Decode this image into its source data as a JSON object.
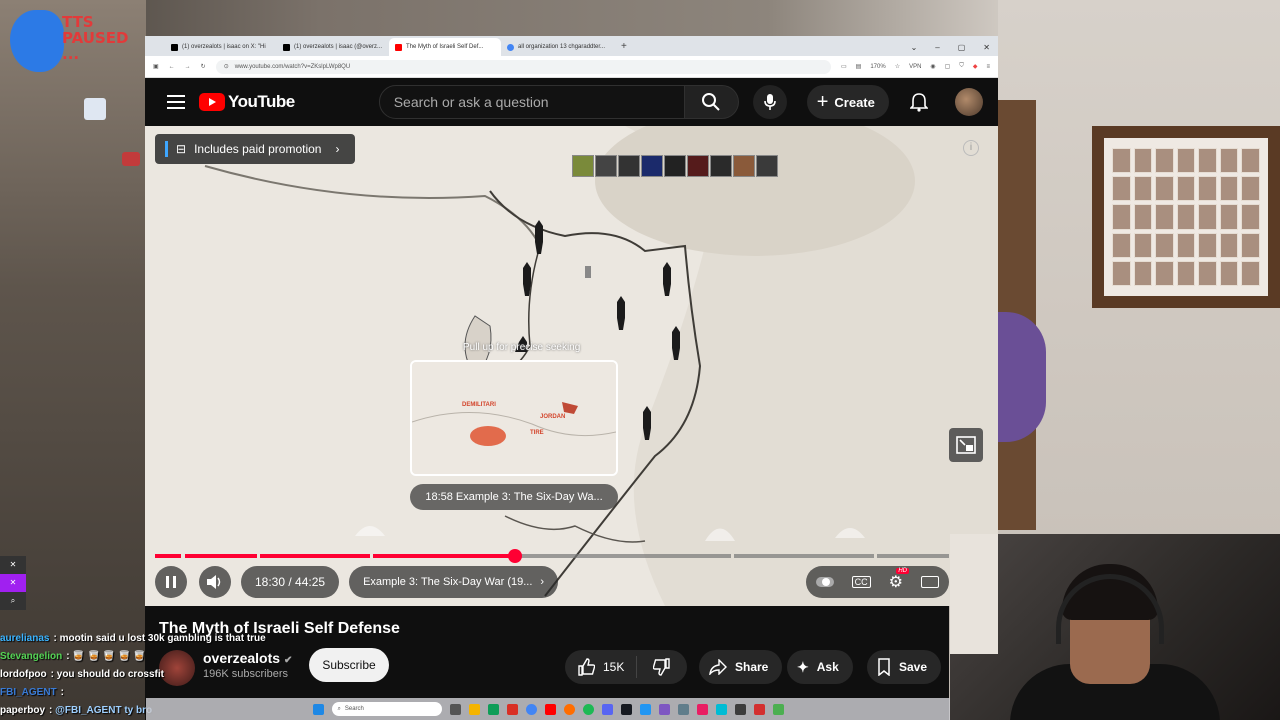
{
  "overlay": {
    "stream_logo_text": "TTS\nPAUSED\n..."
  },
  "browser": {
    "tabs": [
      {
        "label": "(1) overzealots | isaac on X: \"Hi",
        "icon": "x-icon"
      },
      {
        "label": "(1) overzealots | isaac (@overz...",
        "icon": "x-icon"
      },
      {
        "label": "The Myth of Israeli Self Def...",
        "icon": "youtube-icon"
      },
      {
        "label": "all organization 13 chgaraddter...",
        "icon": "google-icon"
      }
    ],
    "url": "www.youtube.com/watch?v=ZKslpLWp8QU",
    "zoom": "170%",
    "vpn": "VPN"
  },
  "youtube": {
    "logo_text": "YouTube",
    "search_placeholder": "Search or ask a question",
    "create_label": "Create",
    "paid_promotion": "Includes paid promotion",
    "seek_hint": "Pull up for precise seeking",
    "preview_chapter": "18:58  Example 3: The Six-Day Wa...",
    "preview_map_labels": [
      "DEMILITARI",
      "JORDAN",
      "TIRE"
    ],
    "time": "18:30 / 44:25",
    "chapter": "Example 3: The Six-Day War (19...",
    "progress_fraction": 0.416,
    "title": "The Myth of Israeli Self Defense",
    "channel": "overzealots",
    "subscribers": "196K subscribers",
    "subscribe_label": "Subscribe",
    "likes": "15K",
    "share_label": "Share",
    "ask_label": "Ask",
    "save_label": "Save"
  },
  "chat": [
    {
      "user": "aurelianas",
      "user_color": "#3ab4ff",
      "message": "mootin said u lost 30k gambling is that true"
    },
    {
      "user": "Stevangelion",
      "user_color": "#55d455",
      "message": "🥃 🥃 🥃 🥃 🥃"
    },
    {
      "user": "lordofpoo",
      "user_color": "#ffffff",
      "message": "you should do crossfit"
    },
    {
      "user": "FBI_AGENT",
      "user_color": "#3a7bd5",
      "message": ""
    },
    {
      "user": "paperboy",
      "user_color": "#ffffff",
      "message": "@FBI_AGENT ty bro"
    }
  ],
  "taskbar": {
    "search_placeholder": "Search"
  },
  "colors": {
    "yt_red": "#ff0033",
    "yt_bg": "#0f0f0f",
    "pill_bg": "#272727"
  }
}
